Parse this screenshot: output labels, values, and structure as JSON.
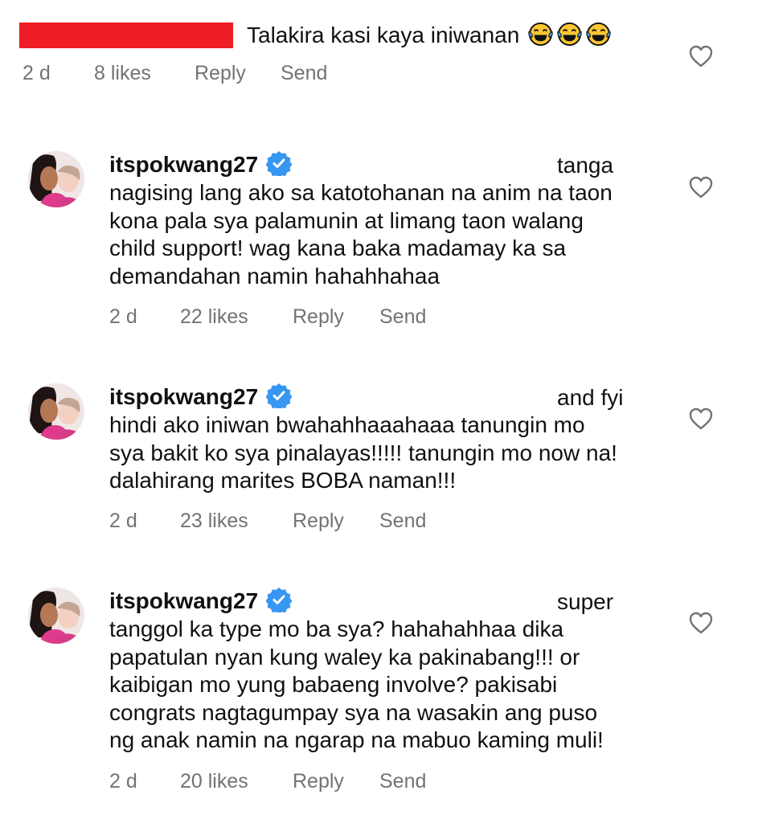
{
  "top_comment": {
    "text": "Talakira kasi kaya iniwanan",
    "emojis": [
      "face-with-tears-of-joy",
      "face-with-tears-of-joy",
      "face-with-tears-of-joy"
    ],
    "time": "2 d",
    "likes": "8 likes",
    "reply": "Reply",
    "send": "Send"
  },
  "comments": [
    {
      "username": "itspokwang27",
      "first_word": "tanga",
      "body": "nagising lang ako sa katotohanan na anim na taon\nkona pala sya palamunin at limang taon walang\nchild support! wag kana baka madamay ka sa\ndemandahan namin hahahhahaa",
      "time": "2 d",
      "likes": "22 likes",
      "reply": "Reply",
      "send": "Send"
    },
    {
      "username": "itspokwang27",
      "first_word": "and fyi",
      "body": "hindi ako iniwan bwahahhaaahaaa tanungin mo\nsya bakit ko sya pinalayas!!!!! tanungin mo now na!\ndalahirang marites BOBA naman!!!",
      "time": "2 d",
      "likes": "23 likes",
      "reply": "Reply",
      "send": "Send"
    },
    {
      "username": "itspokwang27",
      "first_word": "super",
      "body": "tanggol ka type mo ba sya? hahahahhaa dika\npapatulan nyan kung waley ka pakinabang!!! or\nkaibigan mo yung babaeng involve? pakisabi\ncongrats nagtagumpay sya na wasakin ang puso\nng anak namin na ngarap na mabuo kaming muli!",
      "time": "2 d",
      "likes": "20 likes",
      "reply": "Reply",
      "send": "Send"
    }
  ],
  "colors": {
    "redaction": "#ee1c25",
    "verified": "#3797f0",
    "meta_text": "#737373"
  }
}
